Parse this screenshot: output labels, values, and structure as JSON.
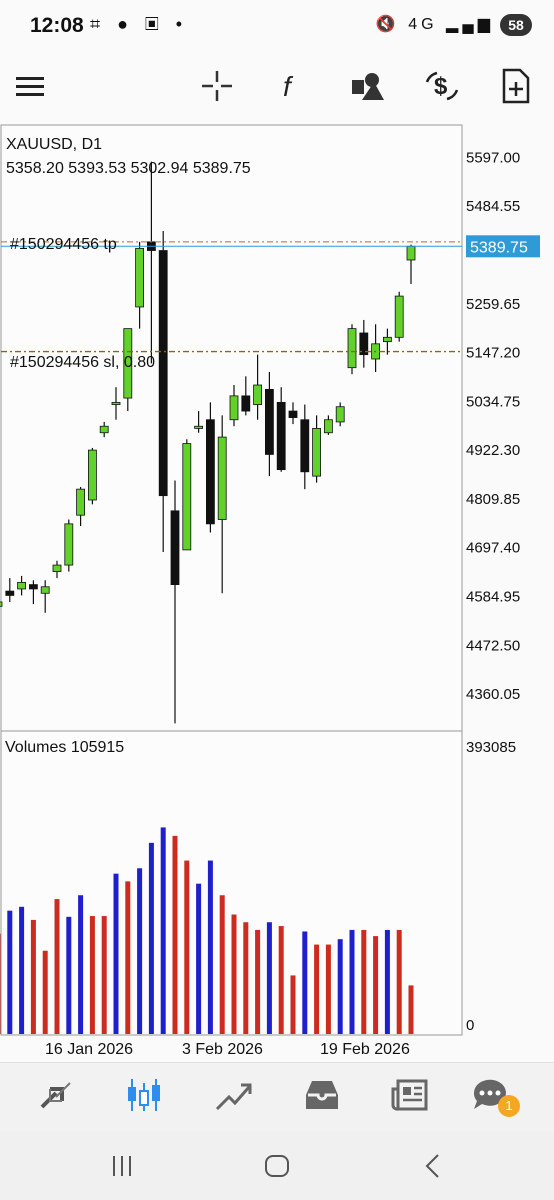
{
  "status": {
    "time": "12:08",
    "network": "4G",
    "battery": "58"
  },
  "toolbar": {
    "icons": [
      "menu-icon",
      "crosshair-icon",
      "indicator-f-icon",
      "objects-icon",
      "trade-dollar-icon",
      "new-order-icon"
    ]
  },
  "chart": {
    "symbol_line": "XAUUSD, D1",
    "ohlc_line": "5358.20 5393.53 5302.94 5389.75",
    "tp_label": "#150294456 tp",
    "sl_label": "#150294456 sl, 0.80",
    "current_price": "5389.75",
    "price_ticks": [
      "5597.00",
      "5484.55",
      "5259.65",
      "5147.20",
      "5034.75",
      "4922.30",
      "4809.85",
      "4697.40",
      "4584.95",
      "4472.50",
      "4360.05"
    ],
    "volumes_label": "Volumes 105915",
    "volume_ticks": [
      "393085",
      "0"
    ],
    "date_labels": [
      "16 Jan 2026",
      "3 Feb 2026",
      "19 Feb 2026"
    ],
    "colors": {
      "bull": "#63d12b",
      "bear": "#111111",
      "vol_up": "#1f1fcc",
      "vol_down": "#cc2b1f",
      "tp_line": "#c8661e",
      "sl_line": "#8a6a00",
      "price_line": "#2e9bd6",
      "price_label_bg": "#2e9bd6"
    }
  },
  "chart_data": {
    "type": "candlestick",
    "candles": [
      {
        "o": 4560,
        "h": 4590,
        "l": 4530,
        "c": 4570
      },
      {
        "o": 4595,
        "h": 4625,
        "l": 4570,
        "c": 4585
      },
      {
        "o": 4600,
        "h": 4630,
        "l": 4585,
        "c": 4615
      },
      {
        "o": 4610,
        "h": 4620,
        "l": 4565,
        "c": 4600
      },
      {
        "o": 4590,
        "h": 4620,
        "l": 4545,
        "c": 4605
      },
      {
        "o": 4640,
        "h": 4665,
        "l": 4625,
        "c": 4655
      },
      {
        "o": 4655,
        "h": 4760,
        "l": 4640,
        "c": 4750
      },
      {
        "o": 4770,
        "h": 4835,
        "l": 4745,
        "c": 4830
      },
      {
        "o": 4805,
        "h": 4925,
        "l": 4795,
        "c": 4920
      },
      {
        "o": 4960,
        "h": 4985,
        "l": 4950,
        "c": 4975
      },
      {
        "o": 5025,
        "h": 5065,
        "l": 4990,
        "c": 5030
      },
      {
        "o": 5040,
        "h": 5190,
        "l": 5010,
        "c": 5200
      },
      {
        "o": 5250,
        "h": 5400,
        "l": 5200,
        "c": 5385
      },
      {
        "o": 5400,
        "h": 5585,
        "l": 5120,
        "c": 5380
      },
      {
        "o": 5380,
        "h": 5425,
        "l": 4685,
        "c": 4815
      },
      {
        "o": 4780,
        "h": 4850,
        "l": 4290,
        "c": 4610
      },
      {
        "o": 4690,
        "h": 4945,
        "l": 4690,
        "c": 4935
      },
      {
        "o": 4970,
        "h": 5010,
        "l": 4960,
        "c": 4975
      },
      {
        "o": 4990,
        "h": 5030,
        "l": 4730,
        "c": 4750
      },
      {
        "o": 4760,
        "h": 5000,
        "l": 4590,
        "c": 4950
      },
      {
        "o": 4990,
        "h": 5070,
        "l": 4975,
        "c": 5045
      },
      {
        "o": 5045,
        "h": 5090,
        "l": 5000,
        "c": 5010
      },
      {
        "o": 5025,
        "h": 5140,
        "l": 4990,
        "c": 5070
      },
      {
        "o": 5060,
        "h": 5100,
        "l": 4860,
        "c": 4910
      },
      {
        "o": 5030,
        "h": 5065,
        "l": 4870,
        "c": 4875
      },
      {
        "o": 5010,
        "h": 5030,
        "l": 4980,
        "c": 4995
      },
      {
        "o": 4990,
        "h": 5025,
        "l": 4830,
        "c": 4870
      },
      {
        "o": 4860,
        "h": 5000,
        "l": 4845,
        "c": 4970
      },
      {
        "o": 4960,
        "h": 5000,
        "l": 4955,
        "c": 4990
      },
      {
        "o": 4985,
        "h": 5030,
        "l": 4975,
        "c": 5020
      },
      {
        "o": 5110,
        "h": 5210,
        "l": 5095,
        "c": 5200
      },
      {
        "o": 5190,
        "h": 5220,
        "l": 5110,
        "c": 5140
      },
      {
        "o": 5130,
        "h": 5210,
        "l": 5100,
        "c": 5165
      },
      {
        "o": 5170,
        "h": 5200,
        "l": 5140,
        "c": 5180
      },
      {
        "o": 5180,
        "h": 5285,
        "l": 5170,
        "c": 5275
      },
      {
        "o": 5358.2,
        "h": 5393.53,
        "l": 5302.94,
        "c": 5389.75
      }
    ],
    "volumes": [
      {
        "v": 130000,
        "up": false
      },
      {
        "v": 160000,
        "up": true
      },
      {
        "v": 165000,
        "up": true
      },
      {
        "v": 148000,
        "up": false
      },
      {
        "v": 108000,
        "up": false
      },
      {
        "v": 175000,
        "up": false
      },
      {
        "v": 152000,
        "up": true
      },
      {
        "v": 180000,
        "up": true
      },
      {
        "v": 153000,
        "up": false
      },
      {
        "v": 153000,
        "up": false
      },
      {
        "v": 208000,
        "up": true
      },
      {
        "v": 198000,
        "up": false
      },
      {
        "v": 215000,
        "up": true
      },
      {
        "v": 248000,
        "up": true
      },
      {
        "v": 268000,
        "up": true
      },
      {
        "v": 257000,
        "up": false
      },
      {
        "v": 225000,
        "up": false
      },
      {
        "v": 195000,
        "up": true
      },
      {
        "v": 225000,
        "up": true
      },
      {
        "v": 180000,
        "up": false
      },
      {
        "v": 155000,
        "up": false
      },
      {
        "v": 145000,
        "up": false
      },
      {
        "v": 135000,
        "up": false
      },
      {
        "v": 145000,
        "up": true
      },
      {
        "v": 140000,
        "up": false
      },
      {
        "v": 76000,
        "up": false
      },
      {
        "v": 133000,
        "up": true
      },
      {
        "v": 116000,
        "up": false
      },
      {
        "v": 116000,
        "up": false
      },
      {
        "v": 123000,
        "up": true
      },
      {
        "v": 135000,
        "up": true
      },
      {
        "v": 135000,
        "up": false
      },
      {
        "v": 127000,
        "up": false
      },
      {
        "v": 135000,
        "up": true
      },
      {
        "v": 135000,
        "up": false
      },
      {
        "v": 63000,
        "up": false
      }
    ],
    "price_range": [
      4272.55,
      5669.36
    ],
    "volume_range": [
      0,
      393085
    ],
    "tp_price": 5400,
    "sl_price": 5147.2
  },
  "bottom_nav": {
    "items": [
      "quotes-icon",
      "chart-icon",
      "trade-icon",
      "history-icon",
      "news-icon",
      "messages-icon"
    ],
    "badge": "1"
  }
}
